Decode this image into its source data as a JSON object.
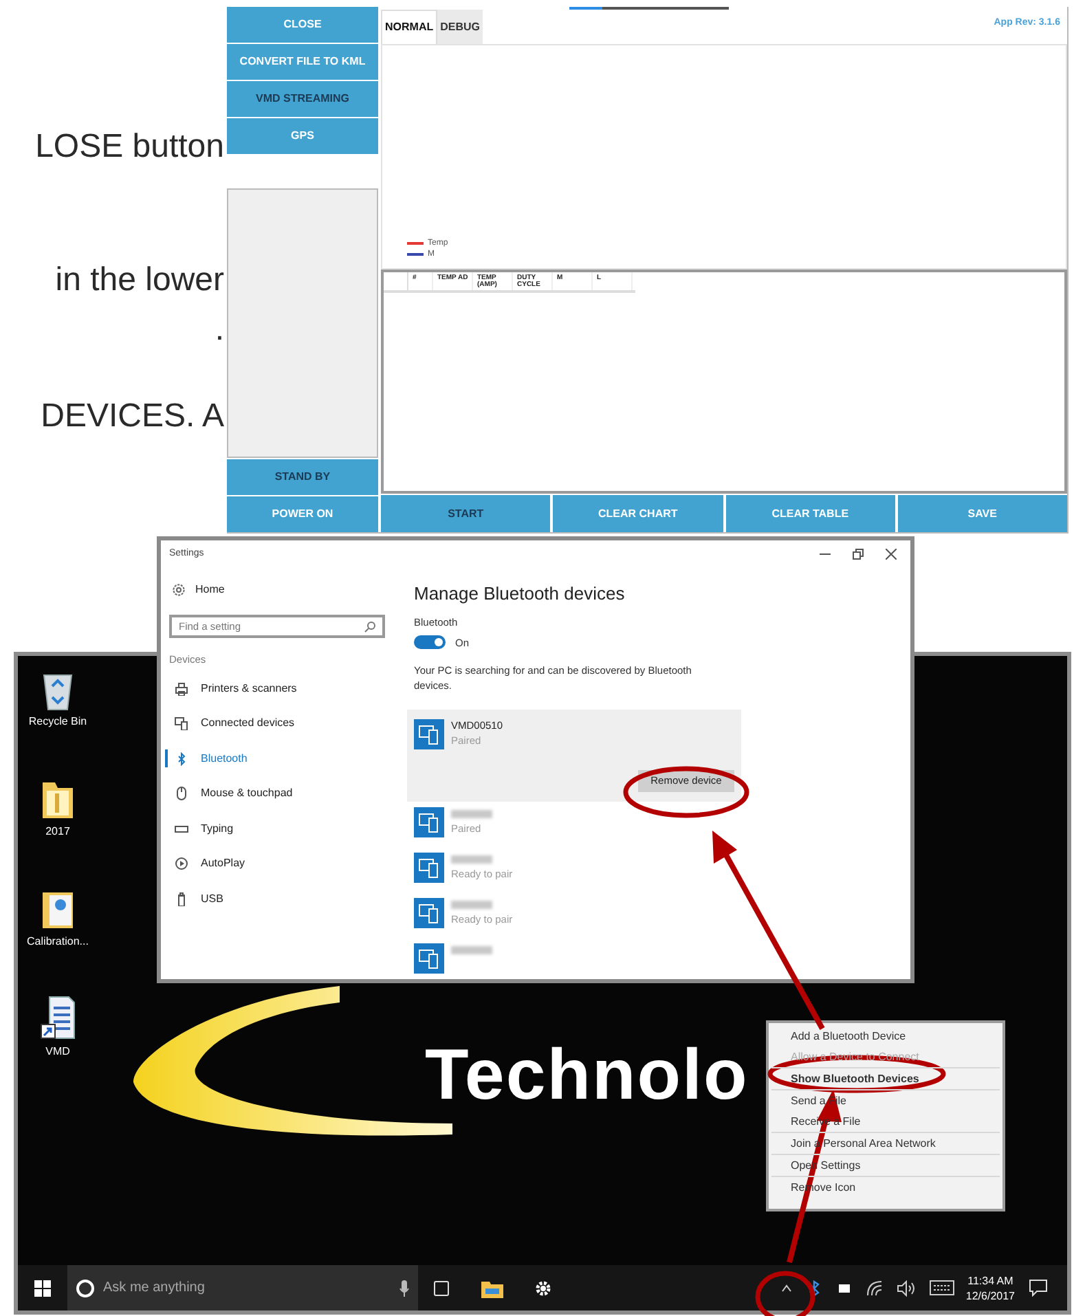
{
  "document_text": [
    {
      "text": "LOSE button"
    },
    {
      "text": "in the lower"
    },
    {
      "text": "."
    },
    {
      "text": "DEVICES. A"
    }
  ],
  "app_window": {
    "progress": {
      "level": 0.21
    },
    "side_buttons_top": [
      {
        "label": "CLOSE",
        "dark_label": false
      },
      {
        "label": "CONVERT FILE TO KML",
        "dark_label": false
      },
      {
        "label": "VMD STREAMING",
        "dark_label": true
      },
      {
        "label": "GPS",
        "dark_label": false
      }
    ],
    "side_buttons_bottom": [
      {
        "label": "STAND BY",
        "dark_label": true
      },
      {
        "label": "POWER ON",
        "dark_label": false
      }
    ],
    "tabs": [
      {
        "label": "NORMAL",
        "selected": true
      },
      {
        "label": "DEBUG",
        "selected": false
      }
    ],
    "app_rev": "App Rev: 3.1.6",
    "legend": [
      {
        "label": "Temp",
        "color": "#e53935"
      },
      {
        "label": "M",
        "color": "#3949ab"
      }
    ],
    "table": {
      "columns": [
        "#",
        "TEMP AD",
        "TEMP (AMP)",
        "DUTY CYCLE",
        "M",
        "L"
      ]
    },
    "bottom_buttons": [
      {
        "label": "START",
        "dark_label": true
      },
      {
        "label": "CLEAR CHART",
        "dark_label": false
      },
      {
        "label": "CLEAR TABLE",
        "dark_label": false
      },
      {
        "label": "SAVE",
        "dark_label": false
      }
    ]
  },
  "desktop": {
    "icons": [
      {
        "label": "Recycle Bin",
        "kind": "recycle"
      },
      {
        "label": "2017",
        "kind": "folder"
      },
      {
        "label": "Calibration...",
        "kind": "document"
      },
      {
        "label": "VMD",
        "kind": "shortcut"
      }
    ],
    "logo_text": "Technolo",
    "taskbar": {
      "search_placeholder": "Ask me anything",
      "time": "11:34 AM",
      "date": "12/6/2017"
    }
  },
  "settings_window": {
    "title": "Settings",
    "home": "Home",
    "search_placeholder": "Find a setting",
    "section": "Devices",
    "nav": [
      {
        "label": "Printers & scanners",
        "kind": "printer",
        "selected": false
      },
      {
        "label": "Connected devices",
        "kind": "connected",
        "selected": false
      },
      {
        "label": "Bluetooth",
        "kind": "bluetooth",
        "selected": true
      },
      {
        "label": "Mouse & touchpad",
        "kind": "mouse",
        "selected": false
      },
      {
        "label": "Typing",
        "kind": "typing",
        "selected": false
      },
      {
        "label": "AutoPlay",
        "kind": "autoplay",
        "selected": false
      },
      {
        "label": "USB",
        "kind": "usb",
        "selected": false
      }
    ],
    "heading": "Manage Bluetooth devices",
    "bluetooth_label": "Bluetooth",
    "toggle": {
      "on": true,
      "label": "On"
    },
    "description": "Your PC is searching for and can be discovered by Bluetooth devices.",
    "devices": [
      {
        "name": "VMD00510",
        "status": "Paired",
        "selected": true,
        "button": "Remove device"
      },
      {
        "status": "Paired",
        "selected": false
      },
      {
        "status": "Ready to pair",
        "selected": false
      },
      {
        "status": "Ready to pair",
        "selected": false
      },
      {
        "selected": false
      }
    ]
  },
  "context_menu": {
    "groups": [
      [
        {
          "label": "Add a Bluetooth Device",
          "bold": false,
          "disabled": false
        },
        {
          "label": "Allow a Device to Connect",
          "bold": false,
          "disabled": true
        }
      ],
      [
        {
          "label": "Show Bluetooth Devices",
          "bold": true,
          "disabled": false
        }
      ],
      [
        {
          "label": "Send a File",
          "bold": false,
          "disabled": false
        },
        {
          "label": "Receive a File",
          "bold": false,
          "disabled": false
        }
      ],
      [
        {
          "label": "Join a Personal Area Network",
          "bold": false,
          "disabled": false
        }
      ],
      [
        {
          "label": "Open Settings",
          "bold": false,
          "disabled": false
        }
      ],
      [
        {
          "label": "Remove Icon",
          "bold": false,
          "disabled": false
        }
      ]
    ]
  }
}
